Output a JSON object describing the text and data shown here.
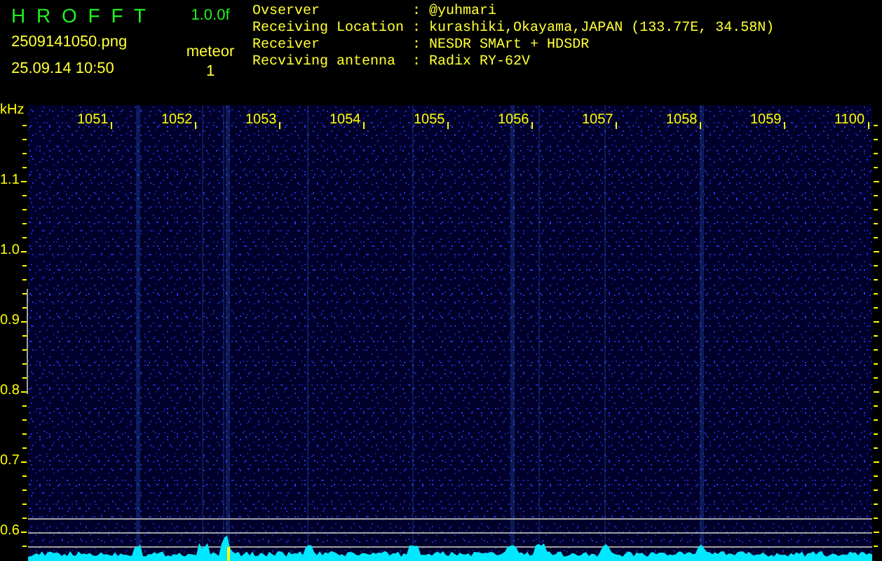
{
  "title": "H R O F F T",
  "version": "1.0.0f",
  "file": "2509141050.png",
  "timestamp": "25.09.14 10:50",
  "count_label": "meteor",
  "count": "1",
  "info": {
    "separator": ":",
    "rows": [
      {
        "label": "Ovserver",
        "value": "@yuhmari"
      },
      {
        "label": "Receiving Location",
        "value": "kurashiki,Okayama,JAPAN (133.77E, 34.58N)"
      },
      {
        "label": "Receiver",
        "value": "NESDR SMArt + HDSDR"
      },
      {
        "label": "Recviving antenna",
        "value": "Radix RY-62V"
      }
    ]
  },
  "axis": {
    "unit": "kHz",
    "freq_labels": [
      "1051",
      "1052",
      "1053",
      "1054",
      "1055",
      "1056",
      "1057",
      "1058",
      "1059",
      "1100"
    ],
    "level_labels": [
      "1.1",
      "1.0",
      "0.9",
      "0.8",
      "0.7",
      "0.6"
    ]
  }
}
